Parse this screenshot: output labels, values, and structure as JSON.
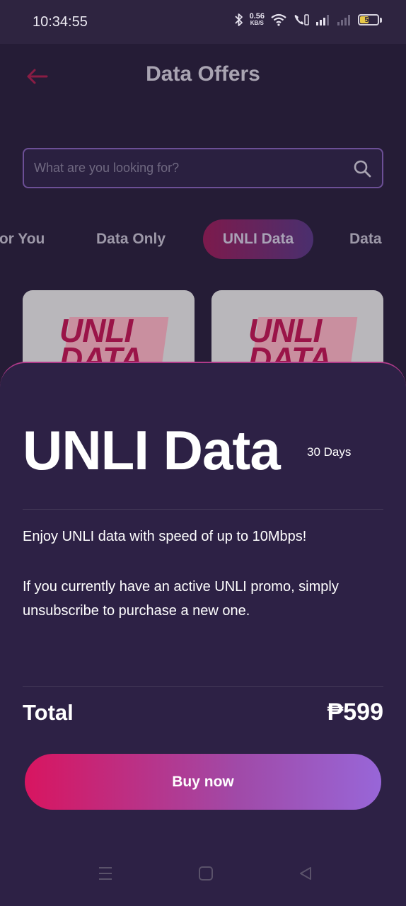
{
  "status_bar": {
    "time": "10:34:55",
    "net_speed_value": "0.56",
    "net_speed_unit": "KB/S",
    "battery_level": "51",
    "battery_fraction": 0.51
  },
  "header": {
    "title": "Data Offers"
  },
  "search": {
    "placeholder": "What are you looking for?"
  },
  "tabs": [
    {
      "label": "For You"
    },
    {
      "label": "Data Only"
    },
    {
      "label": "UNLI Data",
      "active": true
    },
    {
      "label": "Data"
    }
  ],
  "cards": [
    {
      "line1": "UNLI",
      "line2": "DATA"
    },
    {
      "line1": "UNLI",
      "line2": "DATA"
    }
  ],
  "sheet": {
    "title": "UNLI Data",
    "validity": "30 Days",
    "description_1": "Enjoy UNLI data with speed of up to 10Mbps!",
    "description_2": "If you currently have an active UNLI promo, simply unsubscribe to purchase a new one.",
    "total_label": "Total",
    "total_amount": "₱599",
    "buy_label": "Buy now"
  },
  "colors": {
    "accent_pink": "#d81560",
    "accent_purple": "#9866d8",
    "sheet_background": "#2d2145"
  }
}
